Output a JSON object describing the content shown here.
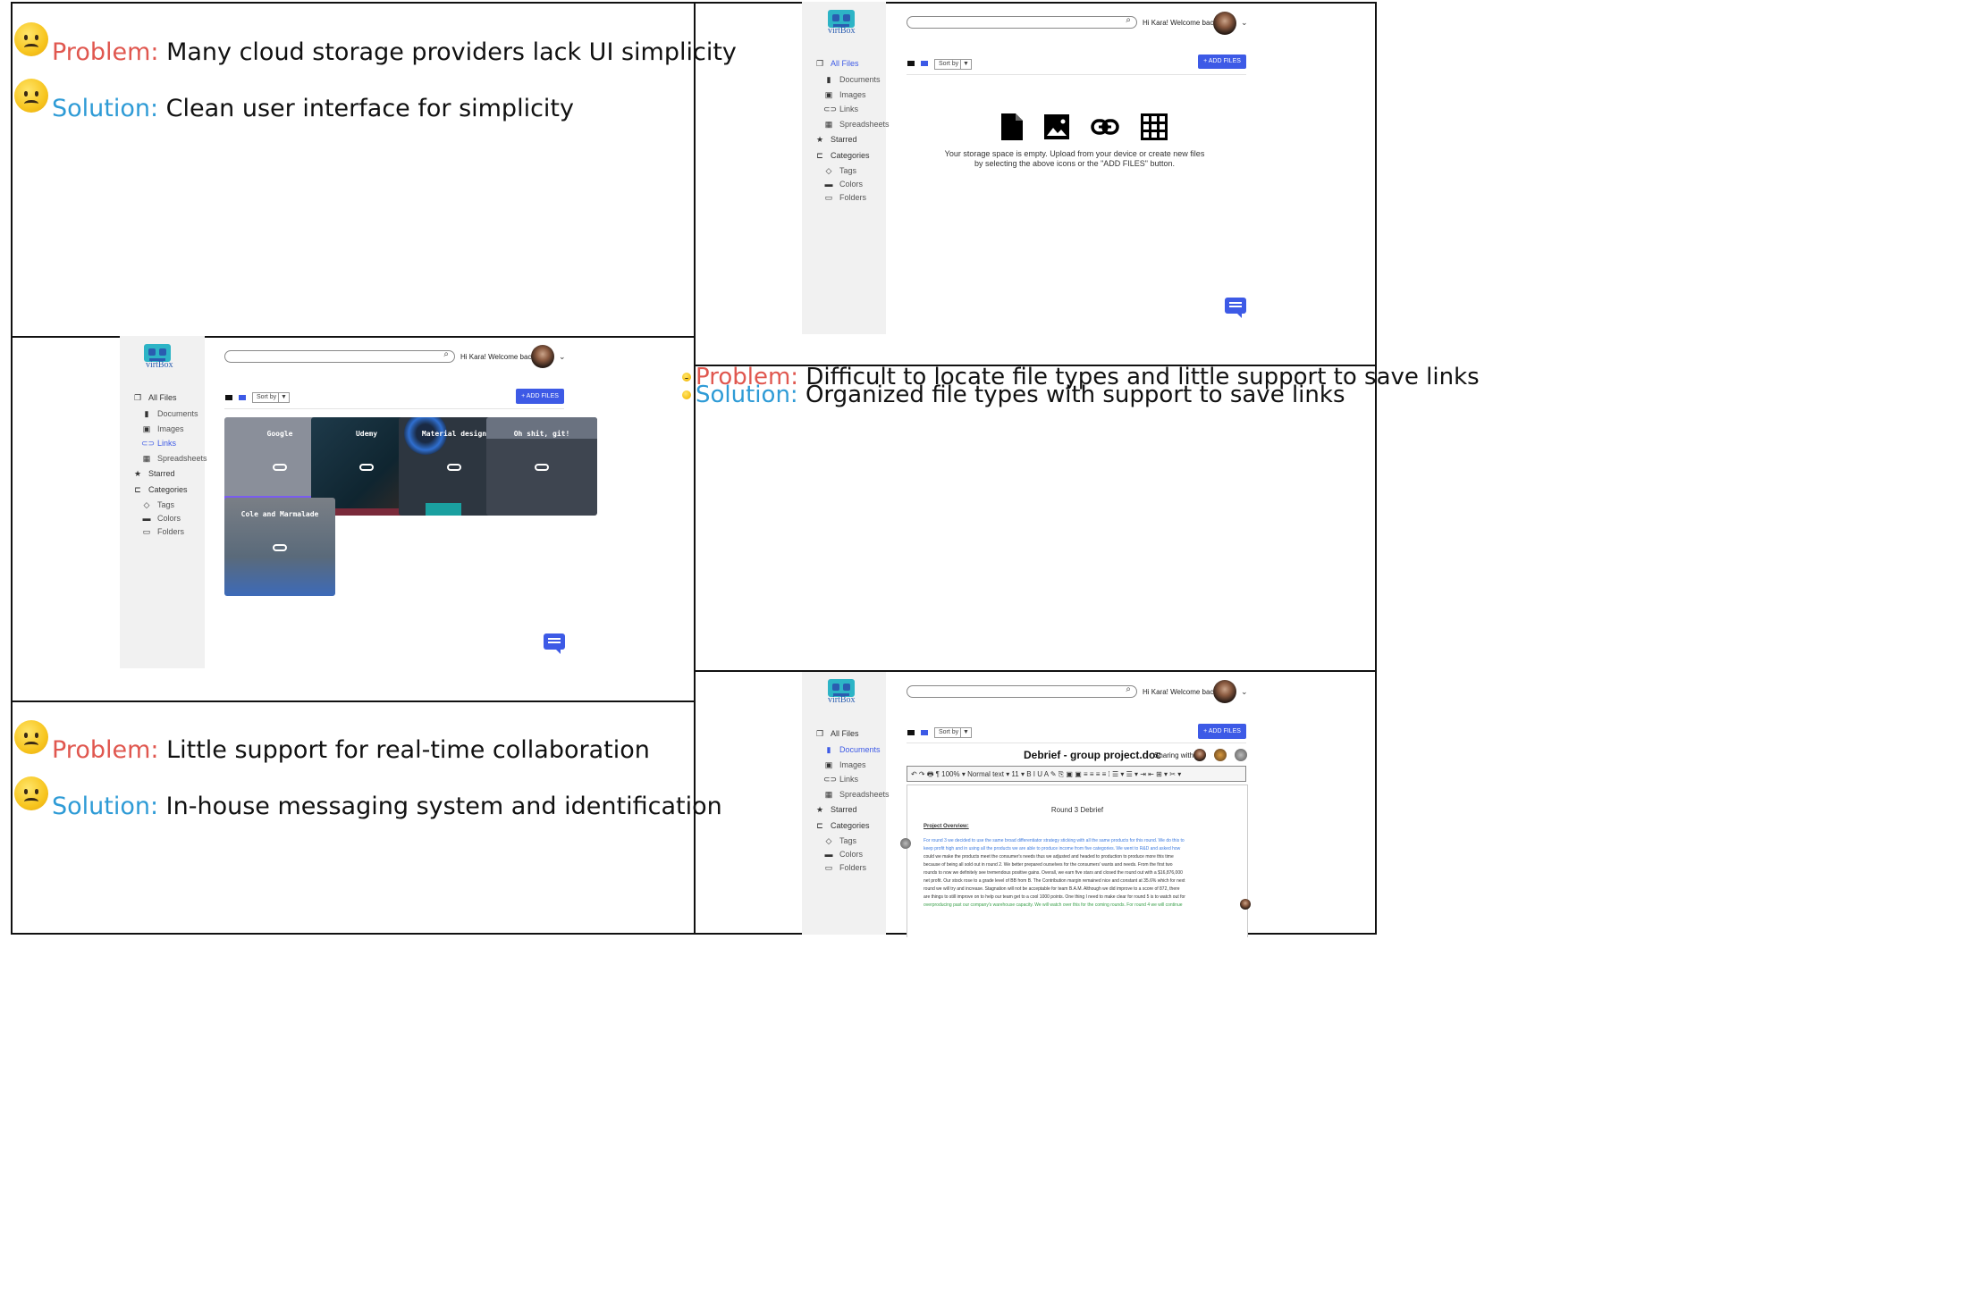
{
  "panels": {
    "p1": {
      "problem_label": "Problem:",
      "problem_text": " Many cloud storage providers lack UI simplicity",
      "solution_label": "Solution:",
      "solution_text": " Clean user interface for simplicity"
    },
    "p2": {
      "problem_label": "Problem:",
      "problem_text": " Difficult to locate file types and little support to save links",
      "solution_label": "Solution:",
      "solution_text": " Organized file types with support to save links"
    },
    "p3": {
      "problem_label": "Problem:",
      "problem_text": " Little support for real-time collaboration",
      "solution_label": "Solution:",
      "solution_text": " In-house messaging system and identification"
    }
  },
  "app": {
    "logo_text": "virtBox",
    "greeting": "Hi Kara! Welcome back",
    "sort_label": "Sort by",
    "add_files": "+ ADD FILES",
    "nav": {
      "all_files": "All Files",
      "documents": "Documents",
      "images": "Images",
      "links": "Links",
      "spreadsheets": "Spreadsheets",
      "starred": "Starred",
      "categories": "Categories",
      "tags": "Tags",
      "colors": "Colors",
      "folders": "Folders"
    },
    "empty_msg_1": "Your storage space is empty. Upload from your device or create new files",
    "empty_msg_2": "by selecting the above icons or the \"ADD FILES\" button.",
    "link_cards": [
      "Google",
      "Udemy",
      "Material design",
      "Oh shit, git!",
      "Cole and Marmalade"
    ],
    "link_card_colors": [
      "#8a8f9a",
      "#1e3a4a",
      "#1a2a44",
      "#3e4550",
      "#5a6a7a"
    ],
    "document": {
      "title": "Debrief -  group project.doc",
      "sharing": "Sharing with:",
      "toolbar": "↶ ↷ 🖶 ¶  100% ▾  Normal text ▾  11 ▾  B  I  U  A  ✎  ⎘ ▣ ▣  ≡ ≡ ≡ ≡  ⁞ ☰ ▾ ☰ ▾ ⇥ ⇤ ⊞ ▾ ✂ ▾",
      "heading": "Round 3 Debrief",
      "overview": "Project Overview:",
      "lines": [
        "For round 3 we decided to use the same broad differentiator strategy sticking with all the same products for this round. We do this to",
        "keep profit high and in using all the products we are able to produce income from five categories. We went to R&D and asked how",
        "could we make the products meet the consumer's needs thus we adjusted and headed to production to produce more this time",
        "because of being all sold out in round 2. We better prepared ourselves for the consumers' wants and needs. From the first two",
        "rounds to now we definitely see tremendous positive gains. Overall, we earn five stars and closed the round out with a $16,876,000",
        "net profit. Our stock rose to a grade level of BB from B. The Contribution margin remained nice and constant at 35.6% which for next",
        "round we will try and increase. Stagnation will not be acceptable for team B.A.M. Although we did improve to a score of 872, there",
        "are things to still improve on to help our team get to a cool 1000 points. One thing I need to make clear for round 5 is to watch out for",
        "overproducing past our company's warehouse capacity. We will watch over this for the coming rounds. For round 4 we will continue"
      ]
    }
  }
}
